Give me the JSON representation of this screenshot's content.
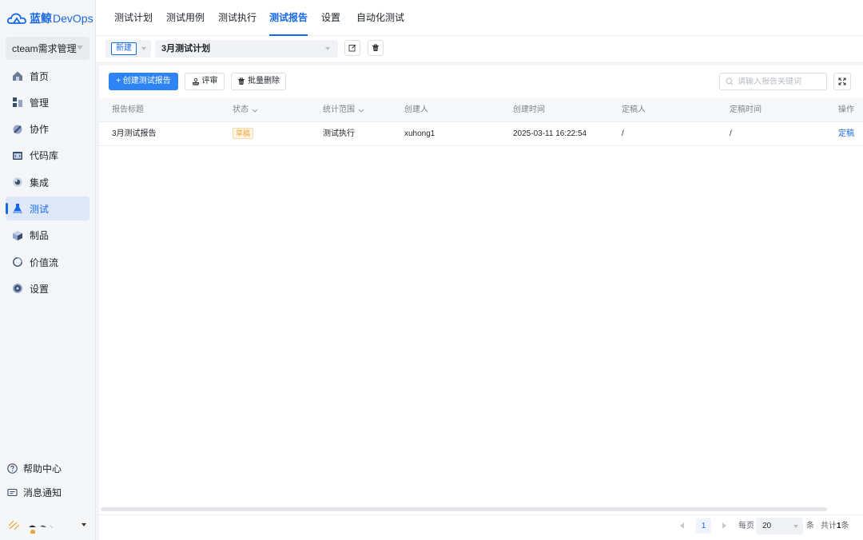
{
  "app": {
    "logo_text": "DevOps",
    "logo_prefix": "蓝鲸",
    "project": "cteam需求管理"
  },
  "sidebar": {
    "items": [
      {
        "label": "首页",
        "icon": "home-icon"
      },
      {
        "label": "管理",
        "icon": "manage-icon"
      },
      {
        "label": "协作",
        "icon": "collab-icon"
      },
      {
        "label": "代码库",
        "icon": "code-repo-icon"
      },
      {
        "label": "集成",
        "icon": "integration-icon"
      },
      {
        "label": "测试",
        "icon": "test-flask-icon",
        "active": true
      },
      {
        "label": "制品",
        "icon": "artifact-cube-icon"
      },
      {
        "label": "价值流",
        "icon": "value-stream-icon"
      },
      {
        "label": "设置",
        "icon": "settings-gear-icon"
      }
    ],
    "bottom": [
      {
        "label": "帮助中心",
        "icon": "help-circle-icon"
      },
      {
        "label": "消息通知",
        "icon": "message-icon"
      }
    ]
  },
  "tabs": [
    {
      "label": "测试计划"
    },
    {
      "label": "测试用例"
    },
    {
      "label": "测试执行"
    },
    {
      "label": "测试报告",
      "active": true
    },
    {
      "label": "设置"
    },
    {
      "label": "自动化测试"
    }
  ],
  "planbar": {
    "new_label": "新建",
    "plan_name": "3月测试计划"
  },
  "toolbar": {
    "create_label": "+ 创建测试报告",
    "review_label": "评审",
    "batch_delete_label": "批量删除",
    "search_placeholder": "请输入报告关键词"
  },
  "table": {
    "columns": [
      "报告标题",
      "状态",
      "统计范围",
      "创建人",
      "创建时间",
      "定稿人",
      "定稿时间",
      "操作"
    ],
    "rows": [
      {
        "title": "3月测试报告",
        "status": "草稿",
        "scope": "测试执行",
        "creator": "xuhong1",
        "created_at": "2025-03-11 16:22:54",
        "finalizer": "/",
        "finalized_at": "/",
        "action": "定稿"
      }
    ]
  },
  "pagination": {
    "current_page": "1",
    "per_page_label": "每页",
    "page_size": "20",
    "unit": "条",
    "total_prefix": "共计",
    "total_count": "1",
    "total_suffix": "条"
  },
  "colors": {
    "brand": "#1768e5",
    "primary_button": "#2e84f5",
    "draft_badge": "#e8a23a"
  }
}
